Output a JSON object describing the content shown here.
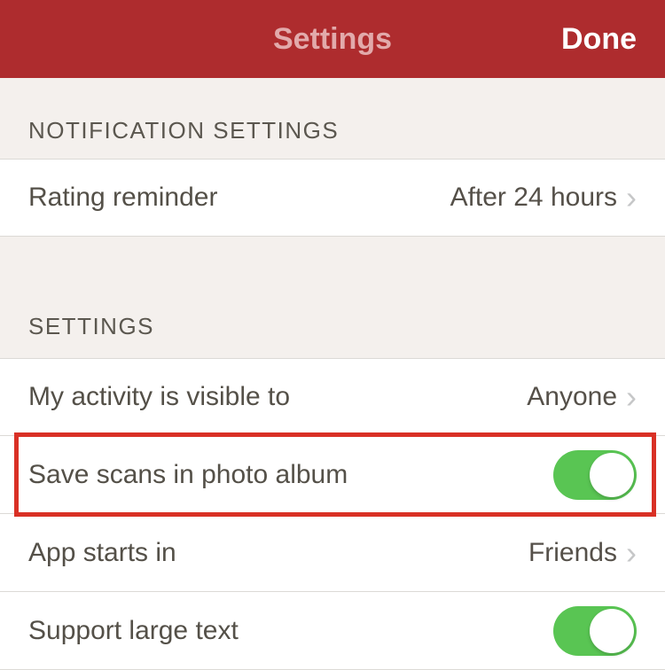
{
  "header": {
    "title": "Settings",
    "done": "Done"
  },
  "sections": {
    "notification": {
      "header": "NOTIFICATION SETTINGS",
      "items": {
        "rating_reminder": {
          "label": "Rating reminder",
          "value": "After 24 hours"
        }
      }
    },
    "settings": {
      "header": "SETTINGS",
      "items": {
        "activity_visible": {
          "label": "My activity is visible to",
          "value": "Anyone"
        },
        "save_scans": {
          "label": "Save scans in photo album",
          "toggle": true
        },
        "app_starts": {
          "label": "App starts in",
          "value": "Friends"
        },
        "large_text": {
          "label": "Support large text",
          "toggle": true
        }
      }
    }
  }
}
